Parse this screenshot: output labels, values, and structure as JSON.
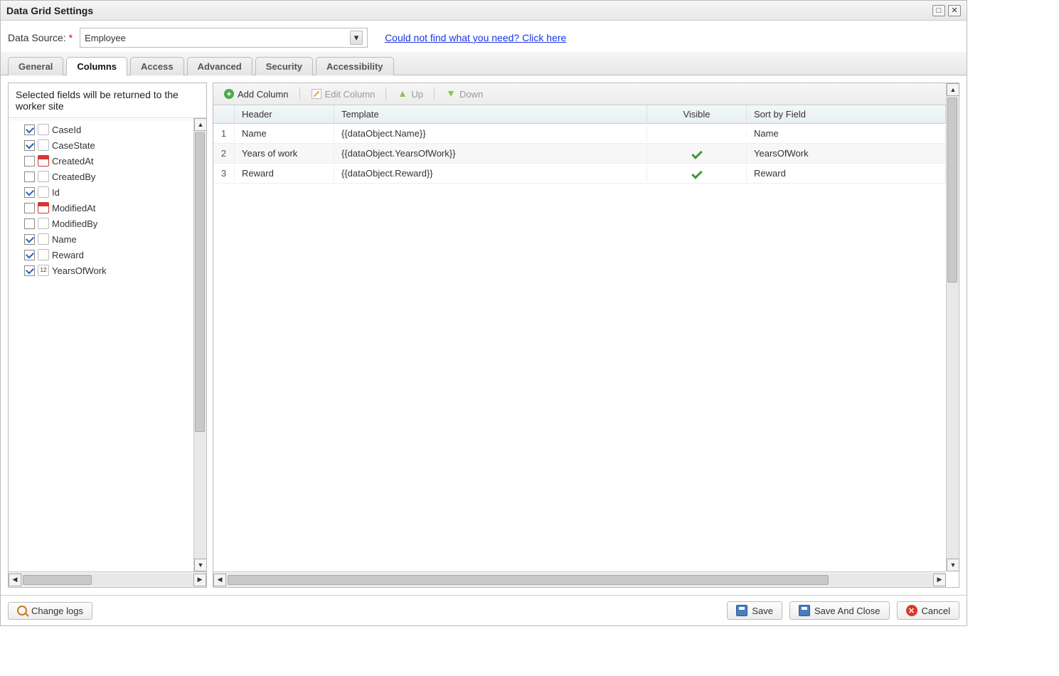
{
  "title": "Data Grid Settings",
  "dataSourceLabel": "Data Source:",
  "required": "*",
  "dataSourceValue": "Employee",
  "helpLink": "Could not find what you need? Click here",
  "tabs": [
    "General",
    "Columns",
    "Access",
    "Advanced",
    "Security",
    "Accessibility"
  ],
  "activeTab": 1,
  "leftHeader": "Selected fields will be returned to the worker site",
  "fields": [
    {
      "name": "CaseId",
      "checked": true,
      "icon": "txt"
    },
    {
      "name": "CaseState",
      "checked": true,
      "icon": "txt"
    },
    {
      "name": "CreatedAt",
      "checked": false,
      "icon": "date"
    },
    {
      "name": "CreatedBy",
      "checked": false,
      "icon": "txt"
    },
    {
      "name": "Id",
      "checked": true,
      "icon": "txt"
    },
    {
      "name": "ModifiedAt",
      "checked": false,
      "icon": "date"
    },
    {
      "name": "ModifiedBy",
      "checked": false,
      "icon": "txt"
    },
    {
      "name": "Name",
      "checked": true,
      "icon": "txt"
    },
    {
      "name": "Reward",
      "checked": true,
      "icon": "txt"
    },
    {
      "name": "YearsOfWork",
      "checked": true,
      "icon": "num"
    }
  ],
  "toolbar": {
    "add": "Add Column",
    "edit": "Edit Column",
    "up": "Up",
    "down": "Down"
  },
  "gridHeaders": {
    "header": "Header",
    "template": "Template",
    "visible": "Visible",
    "sort": "Sort by Field"
  },
  "rows": [
    {
      "idx": "1",
      "header": "Name",
      "template": "{{dataObject.Name}}",
      "visible": false,
      "sort": "Name"
    },
    {
      "idx": "2",
      "header": "Years of work",
      "template": "{{dataObject.YearsOfWork}}",
      "visible": true,
      "sort": "YearsOfWork"
    },
    {
      "idx": "3",
      "header": "Reward",
      "template": "{{dataObject.Reward}}",
      "visible": true,
      "sort": "Reward"
    }
  ],
  "footer": {
    "changelogs": "Change logs",
    "save": "Save",
    "saveclose": "Save And Close",
    "cancel": "Cancel"
  }
}
